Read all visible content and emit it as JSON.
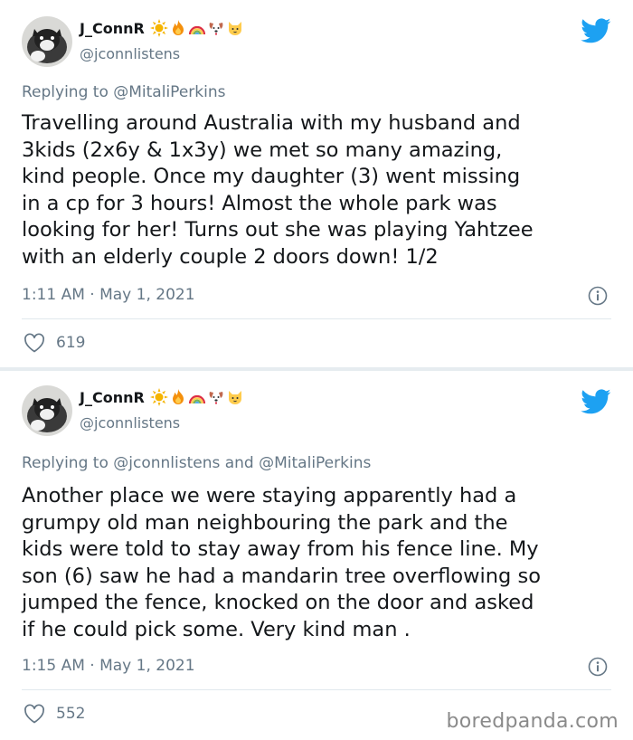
{
  "tweets": [
    {
      "name": "J_ConnR",
      "handle": "@jconnlistens",
      "emojis": [
        "sun-icon",
        "fire-icon",
        "rainbow-icon",
        "dog-face-icon",
        "cat-face-icon"
      ],
      "reply_prefix": "Replying to",
      "reply_to": "@MitaliPerkins",
      "text": "Travelling around Australia with my husband and\n3kids (2x6y & 1x3y) we met so many amazing,\nkind people. Once my daughter (3) went missing\nin a cp for 3 hours! Almost the whole park was\nlooking for her! Turns out she was playing Yahtzee\nwith an elderly couple 2 doors down! 1/2",
      "timestamp": "1:11 AM · May 1, 2021",
      "likes": "619"
    },
    {
      "name": "J_ConnR",
      "handle": "@jconnlistens",
      "emojis": [
        "sun-icon",
        "fire-icon",
        "rainbow-icon",
        "dog-face-icon",
        "cat-face-icon"
      ],
      "reply_prefix": "Replying to",
      "reply_to": "@jconnlistens and @MitaliPerkins",
      "text": "Another place we were staying apparently had a\ngrumpy old man neighbouring the park and the\nkids were told to stay away from his fence line. My\nson (6) saw he had a mandarin tree overflowing so\njumped the fence, knocked on the door and asked\nif he could pick some. Very kind man .",
      "timestamp": "1:15 AM · May 1, 2021",
      "likes": "552"
    }
  ],
  "watermark": "boredpanda.com",
  "colors": {
    "twitter_blue": "#1da1f2",
    "secondary_text": "#657786",
    "primary_text": "#14171a"
  }
}
